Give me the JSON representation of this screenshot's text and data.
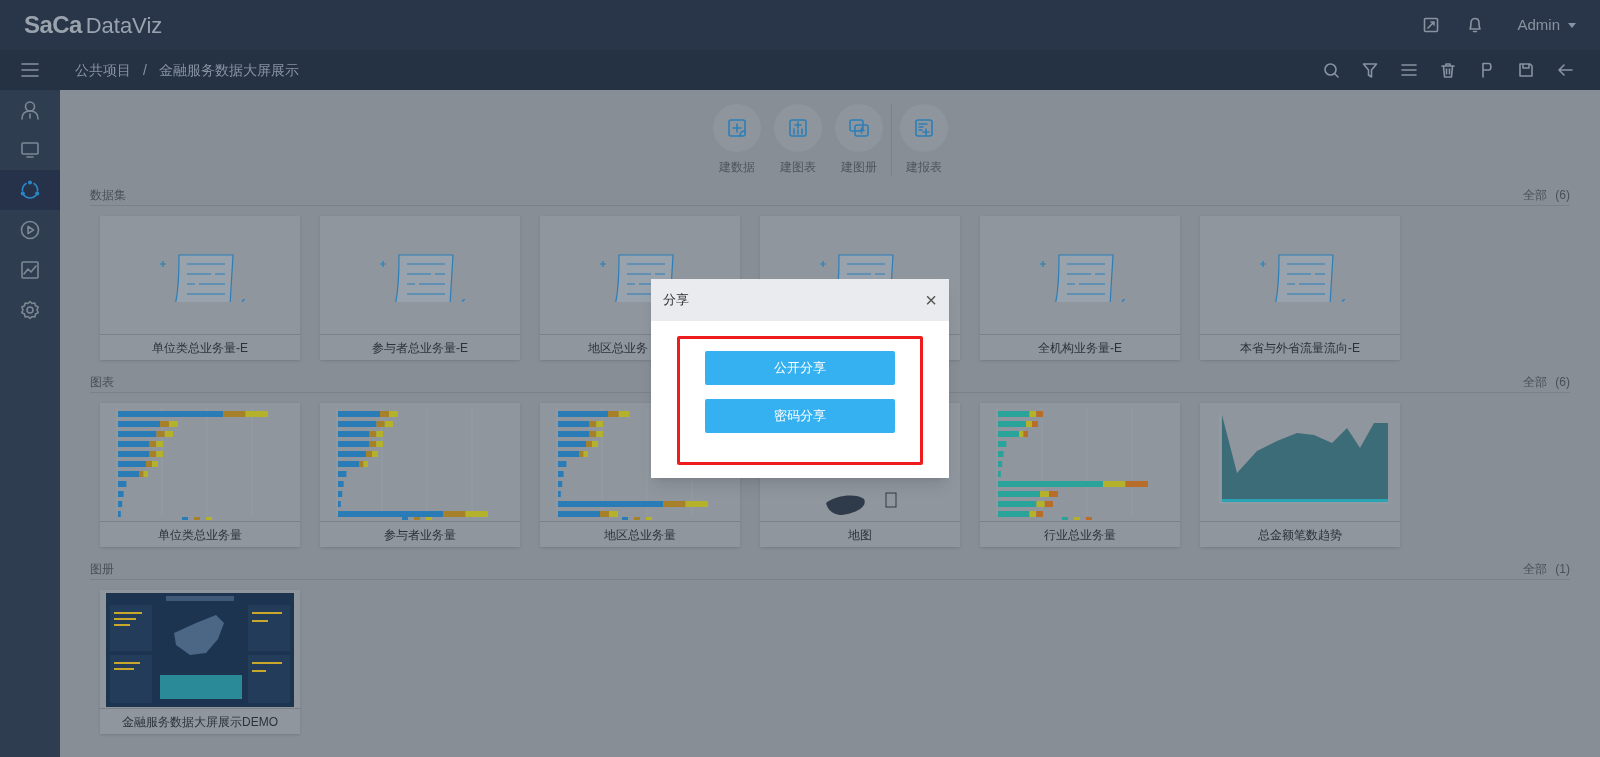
{
  "header": {
    "logo": "SaCa",
    "product": "DataViz",
    "user": "Admin"
  },
  "breadcrumb": {
    "items": [
      "公共项目",
      "金融服务数据大屏展示"
    ],
    "separator": "/"
  },
  "sidebar": [
    {
      "kind": "user",
      "selected": false
    },
    {
      "kind": "monitor",
      "selected": false
    },
    {
      "kind": "share",
      "selected": true
    },
    {
      "kind": "play",
      "selected": false
    },
    {
      "kind": "trend",
      "selected": false
    },
    {
      "kind": "settings",
      "selected": false
    }
  ],
  "create_groups": [
    [
      {
        "kind": "dataset",
        "label": "建数据"
      },
      {
        "kind": "chart",
        "label": "建图表"
      },
      {
        "kind": "album",
        "label": "建图册"
      }
    ],
    [
      {
        "kind": "report",
        "label": "建报表"
      }
    ]
  ],
  "sections": [
    {
      "title": "数据集",
      "total_label": "全部",
      "count": "(6)",
      "items": [
        {
          "kind": "dataset",
          "name": "单位类总业务量-E"
        },
        {
          "kind": "dataset",
          "name": "参与者总业务量-E"
        },
        {
          "kind": "dataset",
          "name": "地区总业务",
          "covered": true
        },
        {
          "kind": "dataset"
        },
        {
          "kind": "dataset",
          "name": "全机构业务量-E"
        },
        {
          "kind": "dataset",
          "name": "本省与外省流量流向-E"
        }
      ]
    },
    {
      "title": "图表",
      "total_label": "全部",
      "count": "(6)",
      "items": [
        {
          "kind": "hbar",
          "name": "单位类总业务量"
        },
        {
          "kind": "hbar",
          "name": "参与者业务量"
        },
        {
          "kind": "hbar",
          "name": "地区总业务量"
        },
        {
          "kind": "map",
          "name": "地图"
        },
        {
          "kind": "hbar",
          "name": "行业总业务量"
        },
        {
          "kind": "area",
          "name": "总金额笔数趋势"
        }
      ]
    },
    {
      "title": "图册",
      "total_label": "全部",
      "count": "(1)",
      "items": [
        {
          "kind": "album",
          "name": "金融服务数据大屏展示DEMO"
        }
      ]
    }
  ],
  "dialog": {
    "title": "分享",
    "close": "×",
    "buttons": [
      "公开分享",
      "密码分享"
    ]
  }
}
